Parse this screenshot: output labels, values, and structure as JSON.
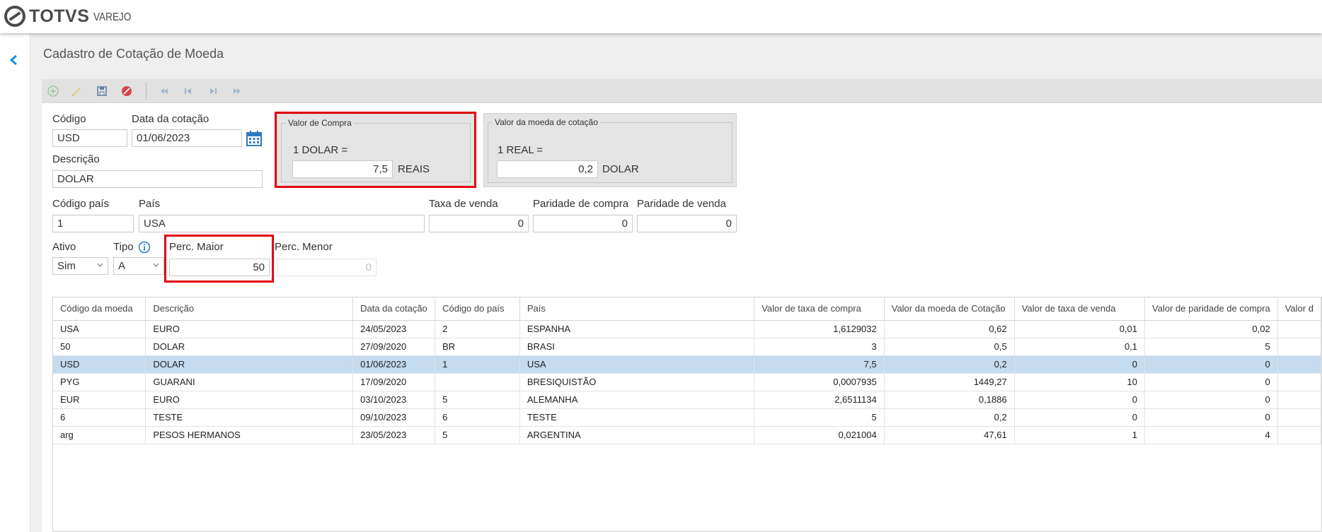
{
  "app": {
    "brand": "TOTVS",
    "product": "VAREJO"
  },
  "page": {
    "title": "Cadastro de Cotação de Moeda"
  },
  "form": {
    "codigo": {
      "label": "Código",
      "value": "USD"
    },
    "data_cotacao": {
      "label": "Data da cotação",
      "value": "01/06/2023"
    },
    "descricao": {
      "label": "Descrição",
      "value": "DOLAR"
    },
    "valor_compra": {
      "title": "Valor de Compra",
      "prefix": "1 DOLAR =",
      "value": "7,5",
      "suffix": "REAIS"
    },
    "valor_moeda_cotacao": {
      "title": "Valor da moeda de cotação",
      "prefix": "1 REAL =",
      "value": "0,2",
      "suffix": "DOLAR"
    },
    "codigo_pais": {
      "label": "Código país",
      "value": "1"
    },
    "pais": {
      "label": "País",
      "value": "USA"
    },
    "taxa_venda": {
      "label": "Taxa de venda",
      "value": "0"
    },
    "paridade_compra": {
      "label": "Paridade de compra",
      "value": "0"
    },
    "paridade_venda": {
      "label": "Paridade de venda",
      "value": "0"
    },
    "ativo": {
      "label": "Ativo",
      "value": "Sim"
    },
    "tipo": {
      "label": "Tipo",
      "value": "A"
    },
    "perc_maior": {
      "label": "Perc. Maior",
      "value": "50"
    },
    "perc_menor": {
      "label": "Perc. Menor",
      "value": "0"
    }
  },
  "toolbar": {
    "icons": [
      "add-icon",
      "edit-icon",
      "save-icon",
      "cancel-icon",
      "first-record-icon",
      "previous-record-icon",
      "next-record-icon",
      "last-record-icon"
    ]
  },
  "colors": {
    "highlight": "#e4000f",
    "selected_row": "#c4dbf0",
    "accent": "#1a8fd9"
  },
  "table": {
    "columns": [
      "Código da moeda",
      "Descrição",
      "Data da cotação",
      "Código do país",
      "País",
      "Valor de taxa de compra",
      "Valor da moeda de Cotação",
      "Valor de taxa de venda",
      "Valor de paridade de compra",
      "Valor d"
    ],
    "rows": [
      [
        "USA",
        "EURO",
        "24/05/2023",
        "2",
        "ESPANHA",
        "1,6129032",
        "0,62",
        "0,01",
        "0,02",
        ""
      ],
      [
        "50",
        "DOLAR",
        "27/09/2020",
        "BR",
        "BRASI",
        "3",
        "0,5",
        "0,1",
        "5",
        ""
      ],
      [
        "USD",
        "DOLAR",
        "01/06/2023",
        "1",
        "USA",
        "7,5",
        "0,2",
        "0",
        "0",
        ""
      ],
      [
        "PYG",
        "GUARANI",
        "17/09/2020",
        "",
        "BRESIQUISTÃO",
        "0,0007935",
        "1449,27",
        "10",
        "0",
        ""
      ],
      [
        "EUR",
        "EURO",
        "03/10/2023",
        "5",
        "ALEMANHA",
        "2,6511134",
        "0,1886",
        "0",
        "0",
        ""
      ],
      [
        "6",
        "TESTE",
        "09/10/2023",
        "6",
        "TESTE",
        "5",
        "0,2",
        "0",
        "0",
        ""
      ],
      [
        "arg",
        "PESOS HERMANOS",
        "23/05/2023",
        "5",
        "ARGENTINA",
        "0,021004",
        "47,61",
        "1",
        "4",
        ""
      ]
    ],
    "selected_row": 2
  }
}
